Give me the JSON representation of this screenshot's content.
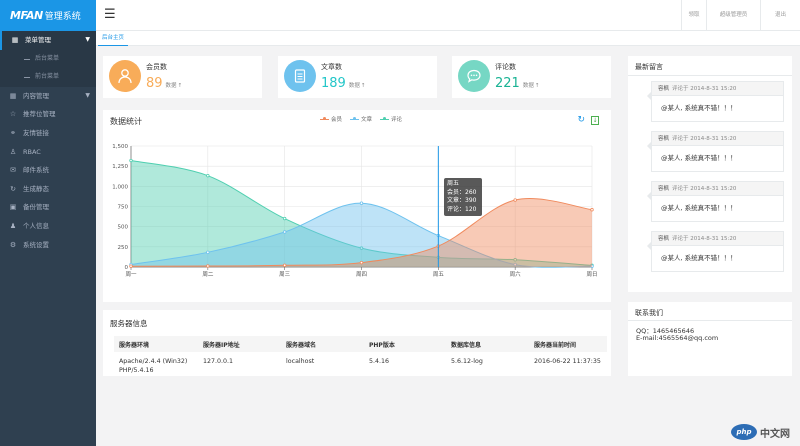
{
  "sidebar": {
    "logo_brand": "MFAN",
    "logo_text": "管理系统",
    "items": [
      {
        "label": "菜单管理",
        "icon": "grid-icon"
      },
      {
        "label": "后台菜单",
        "icon": ""
      },
      {
        "label": "前台菜单",
        "icon": ""
      },
      {
        "label": "内容管理",
        "icon": "grid-icon"
      },
      {
        "label": "推荐位管理",
        "icon": "star-icon"
      },
      {
        "label": "友情链接",
        "icon": "link-icon"
      },
      {
        "label": "RBAC",
        "icon": "user-icon"
      },
      {
        "label": "邮件系统",
        "icon": "mail-icon"
      },
      {
        "label": "生成静态",
        "icon": "refresh-icon"
      },
      {
        "label": "备份管理",
        "icon": "backup-icon"
      },
      {
        "label": "个人信息",
        "icon": "person-icon"
      },
      {
        "label": "系统设置",
        "icon": "gear-icon"
      }
    ]
  },
  "topbar": {
    "btn1": "领取",
    "btn2": "超级管理员",
    "btn3": "退出"
  },
  "tabs": {
    "home": "后台主页"
  },
  "stats": [
    {
      "label": "会员数",
      "value": "89",
      "unit": "数据",
      "color": "#f8ac59"
    },
    {
      "label": "文章数",
      "value": "189",
      "unit": "数据",
      "color": "#23c6c8"
    },
    {
      "label": "评论数",
      "value": "221",
      "unit": "数据",
      "color": "#1ab394"
    }
  ],
  "chart_panel": {
    "title": "数据统计"
  },
  "chart_data": {
    "type": "area",
    "title": "数据统计",
    "categories": [
      "周一",
      "周二",
      "周三",
      "周四",
      "周五",
      "周六",
      "周日"
    ],
    "ylim": [
      0,
      1500
    ],
    "yticks": [
      "0",
      "250",
      "500",
      "750",
      "1,000",
      "1,250",
      "1,500"
    ],
    "series": [
      {
        "name": "会员",
        "color": "#f08a5d",
        "values": [
          10,
          12,
          21,
          54,
          260,
          830,
          710
        ]
      },
      {
        "name": "文章",
        "color": "#6ec2ee",
        "values": [
          30,
          182,
          434,
          791,
          390,
          30,
          10
        ]
      },
      {
        "name": "评论",
        "color": "#4fcfb0",
        "values": [
          1320,
          1132,
          601,
          234,
          120,
          90,
          20
        ]
      }
    ],
    "tooltip": {
      "title": "周五",
      "rows": [
        "会员：260",
        "文章：390",
        "评论：120"
      ]
    }
  },
  "messages": {
    "title": "最新留言",
    "items": [
      {
        "author": "容枫",
        "time": "评论于 2014-8-31 15:20",
        "text": "@某人, 系统真不错！！！"
      },
      {
        "author": "容枫",
        "time": "评论于 2014-8-31 15:20",
        "text": "@某人, 系统真不错！！！"
      },
      {
        "author": "容枫",
        "time": "评论于 2014-8-31 15:20",
        "text": "@某人, 系统真不错！！！"
      },
      {
        "author": "容枫",
        "time": "评论于 2014-8-31 15:20",
        "text": "@某人, 系统真不错！！！"
      }
    ]
  },
  "server": {
    "title": "服务器信息",
    "headers": [
      "服务器环境",
      "服务器IP地址",
      "服务器域名",
      "PHP版本",
      "数据库信息",
      "服务器当前时间"
    ],
    "row": [
      "Apache/2.4.4 (Win32) PHP/5.4.16",
      "127.0.0.1",
      "localhost",
      "5.4.16",
      "5.6.12-log",
      "2016-06-22 11:37:35"
    ]
  },
  "contact": {
    "title": "联系我们",
    "qq": "QQ：1465465646",
    "email": "E-mail:4565564@qq.com"
  },
  "watermark": {
    "logo": "php",
    "text": "中文网"
  }
}
